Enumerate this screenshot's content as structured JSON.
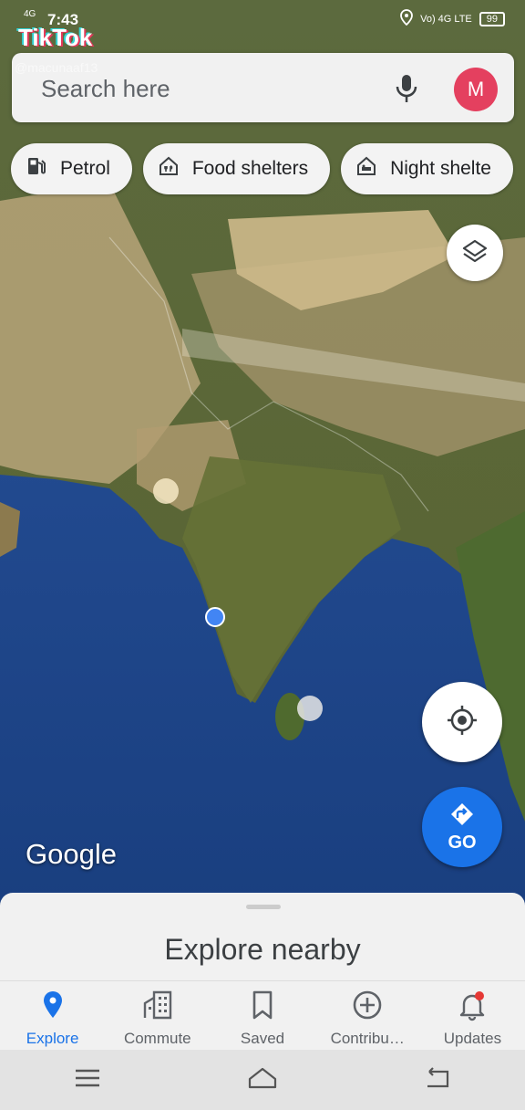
{
  "status_bar": {
    "time": "7:43",
    "network": "4G",
    "signal": "Vo) 4G LTE",
    "battery": "99"
  },
  "overlay": {
    "brand": "TikTok",
    "handle": "@macunaaf13"
  },
  "search": {
    "placeholder": "Search here",
    "avatar_letter": "M"
  },
  "chips": [
    {
      "label": "Petrol",
      "icon": "fuel-pump-icon"
    },
    {
      "label": "Food shelters",
      "icon": "food-shelter-icon"
    },
    {
      "label": "Night shelte",
      "icon": "night-shelter-icon"
    }
  ],
  "map": {
    "watermark": "Google"
  },
  "fab": {
    "go_label": "GO"
  },
  "sheet": {
    "title": "Explore nearby"
  },
  "bottom_nav": [
    {
      "label": "Explore",
      "icon": "pin-icon",
      "active": true
    },
    {
      "label": "Commute",
      "icon": "building-icon"
    },
    {
      "label": "Saved",
      "icon": "bookmark-icon"
    },
    {
      "label": "Contribu…",
      "icon": "plus-circle-icon"
    },
    {
      "label": "Updates",
      "icon": "bell-icon"
    }
  ],
  "colors": {
    "accent": "#1a73e8",
    "avatar": "#e4405f",
    "ocean": "#1f3f7a"
  }
}
